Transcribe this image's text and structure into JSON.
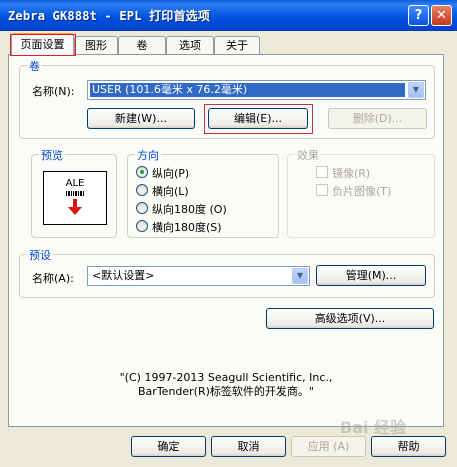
{
  "window": {
    "title": "Zebra GK888t - EPL 打印首选项"
  },
  "tabs": [
    {
      "label": "页面设置"
    },
    {
      "label": "图形"
    },
    {
      "label": "卷"
    },
    {
      "label": "选项"
    },
    {
      "label": "关于"
    }
  ],
  "stock": {
    "legend": "卷",
    "name_label": "名称(N):",
    "name_value": "USER (101.6毫米 x 76.2毫米)",
    "new_label": "新建(W)...",
    "edit_label": "编辑(E)...",
    "delete_label": "删除(D)..."
  },
  "preview": {
    "legend": "预览",
    "text": "ALE"
  },
  "orientation": {
    "legend": "方向",
    "options": [
      {
        "label": "纵向(P)",
        "checked": true
      },
      {
        "label": "横向(L)",
        "checked": false
      },
      {
        "label": "纵向180度 (O)",
        "checked": false
      },
      {
        "label": "横向180度(S)",
        "checked": false
      }
    ]
  },
  "effects": {
    "legend": "效果",
    "mirror_label": "镜像(R)",
    "negative_label": "负片图像(T)"
  },
  "presets": {
    "legend": "预设",
    "name_label": "名称(A):",
    "name_value": "<默认设置>",
    "manage_label": "管理(M)..."
  },
  "advanced_label": "高级选项(V)...",
  "copyright": {
    "line1": "\"(C) 1997-2013 Seagull Scientific, Inc.,",
    "line2": "BarTender(R)标签软件的开发商。\""
  },
  "footer": {
    "ok_label": "确定",
    "cancel_label": "取消",
    "apply_label": "应用 (A)",
    "help_label": "帮助"
  },
  "watermark": "Bai 经验",
  "colors": {
    "titlebar": "#0054E3",
    "accent_blue": "#0046D5",
    "selection": "#316AC5",
    "highlight_red": "#E02020",
    "arrow_red": "#E01010"
  }
}
